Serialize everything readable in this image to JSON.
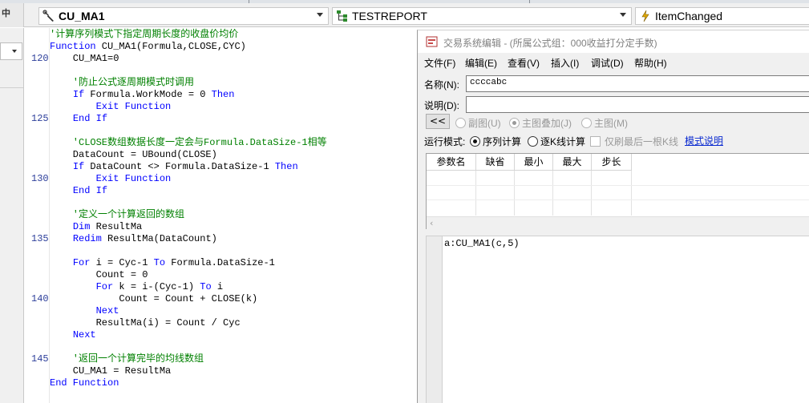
{
  "toolbar": {
    "left_stub": "中",
    "procedure_combo": "CU_MA1",
    "report_combo": "TESTREPORT",
    "event_combo": "ItemChanged"
  },
  "icons": {
    "procedure_icon": "wrench-icon",
    "report_icon": "tree-structure-icon",
    "event_icon": "lightning-icon",
    "dialog_icon": "app-icon"
  },
  "editor": {
    "line_numbers": [
      {
        "n": "120",
        "row": 2
      },
      {
        "n": "125",
        "row": 7
      },
      {
        "n": "130",
        "row": 12
      },
      {
        "n": "135",
        "row": 17
      },
      {
        "n": "140",
        "row": 22
      },
      {
        "n": "145",
        "row": 27
      }
    ],
    "lines": [
      [
        {
          "t": "'计算序列模式下指定周期长度的收盘价均价",
          "c": "cm"
        }
      ],
      [
        {
          "t": "Function",
          "c": "kw"
        },
        {
          "t": " CU_MA1(Formula,CLOSE,CYC)",
          "c": ""
        }
      ],
      [
        {
          "t": "    CU_MA1=0",
          "c": ""
        }
      ],
      [
        {
          "t": "",
          "c": ""
        }
      ],
      [
        {
          "t": "    '防止公式逐周期模式时调用",
          "c": "cm"
        }
      ],
      [
        {
          "t": "    ",
          "c": ""
        },
        {
          "t": "If",
          "c": "kw"
        },
        {
          "t": " Formula.WorkMode = 0 ",
          "c": ""
        },
        {
          "t": "Then",
          "c": "kw"
        }
      ],
      [
        {
          "t": "        ",
          "c": ""
        },
        {
          "t": "Exit Function",
          "c": "kw"
        }
      ],
      [
        {
          "t": "    ",
          "c": ""
        },
        {
          "t": "End If",
          "c": "kw"
        }
      ],
      [
        {
          "t": "",
          "c": ""
        }
      ],
      [
        {
          "t": "    'CLOSE数组数据长度一定会与Formula.DataSize-1相等",
          "c": "cm"
        }
      ],
      [
        {
          "t": "    DataCount = UBound(CLOSE)",
          "c": ""
        }
      ],
      [
        {
          "t": "    ",
          "c": ""
        },
        {
          "t": "If",
          "c": "kw"
        },
        {
          "t": " DataCount <> Formula.DataSize-1 ",
          "c": ""
        },
        {
          "t": "Then",
          "c": "kw"
        }
      ],
      [
        {
          "t": "        ",
          "c": ""
        },
        {
          "t": "Exit Function",
          "c": "kw"
        }
      ],
      [
        {
          "t": "    ",
          "c": ""
        },
        {
          "t": "End If",
          "c": "kw"
        }
      ],
      [
        {
          "t": "",
          "c": ""
        }
      ],
      [
        {
          "t": "    '定义一个计算返回的数组",
          "c": "cm"
        }
      ],
      [
        {
          "t": "    ",
          "c": ""
        },
        {
          "t": "Dim",
          "c": "kw"
        },
        {
          "t": " ResultMa",
          "c": ""
        }
      ],
      [
        {
          "t": "    ",
          "c": ""
        },
        {
          "t": "Redim",
          "c": "kw"
        },
        {
          "t": " ResultMa(DataCount)",
          "c": ""
        }
      ],
      [
        {
          "t": "",
          "c": ""
        }
      ],
      [
        {
          "t": "    ",
          "c": ""
        },
        {
          "t": "For",
          "c": "kw"
        },
        {
          "t": " i = Cyc-1 ",
          "c": ""
        },
        {
          "t": "To",
          "c": "kw"
        },
        {
          "t": " Formula.DataSize-1",
          "c": ""
        }
      ],
      [
        {
          "t": "        Count = 0",
          "c": ""
        }
      ],
      [
        {
          "t": "        ",
          "c": ""
        },
        {
          "t": "For",
          "c": "kw"
        },
        {
          "t": " k = i-(Cyc-1) ",
          "c": ""
        },
        {
          "t": "To",
          "c": "kw"
        },
        {
          "t": " i",
          "c": ""
        }
      ],
      [
        {
          "t": "            Count = Count + CLOSE(k)",
          "c": ""
        }
      ],
      [
        {
          "t": "        ",
          "c": ""
        },
        {
          "t": "Next",
          "c": "kw"
        }
      ],
      [
        {
          "t": "        ResultMa(i) = Count / Cyc",
          "c": ""
        }
      ],
      [
        {
          "t": "    ",
          "c": ""
        },
        {
          "t": "Next",
          "c": "kw"
        }
      ],
      [
        {
          "t": "",
          "c": ""
        }
      ],
      [
        {
          "t": "    '返回一个计算完毕的均线数组",
          "c": "cm"
        }
      ],
      [
        {
          "t": "    CU_MA1 = ResultMa",
          "c": ""
        }
      ],
      [
        {
          "t": "End Function",
          "c": "kw"
        }
      ]
    ]
  },
  "dialog": {
    "title": "交易系统编辑 - (所属公式组：000收益打分定手数)",
    "menu": [
      "文件(F)",
      "编辑(E)",
      "查看(V)",
      "插入(I)",
      "调试(D)",
      "帮助(H)"
    ],
    "name_label": "名称(N):",
    "name_value": "ccccabc",
    "desc_label": "说明(D):",
    "desc_value": "",
    "back_button": "<<",
    "chart_options": [
      "副图(U)",
      "主图叠加(J)",
      "主图(M)"
    ],
    "chart_selected": "主图叠加(J)",
    "run_mode_label": "运行模式:",
    "run_modes": [
      "序列计算",
      "逐K线计算"
    ],
    "run_mode_selected": "序列计算",
    "last_bar_checkbox": "仅刷最后一根K线",
    "last_bar_checked": false,
    "mode_help_link": "模式说明",
    "param_columns": [
      "参数名",
      "缺省",
      "最小",
      "最大",
      "步长"
    ],
    "formula_text": "a:CU_MA1(c,5)"
  }
}
